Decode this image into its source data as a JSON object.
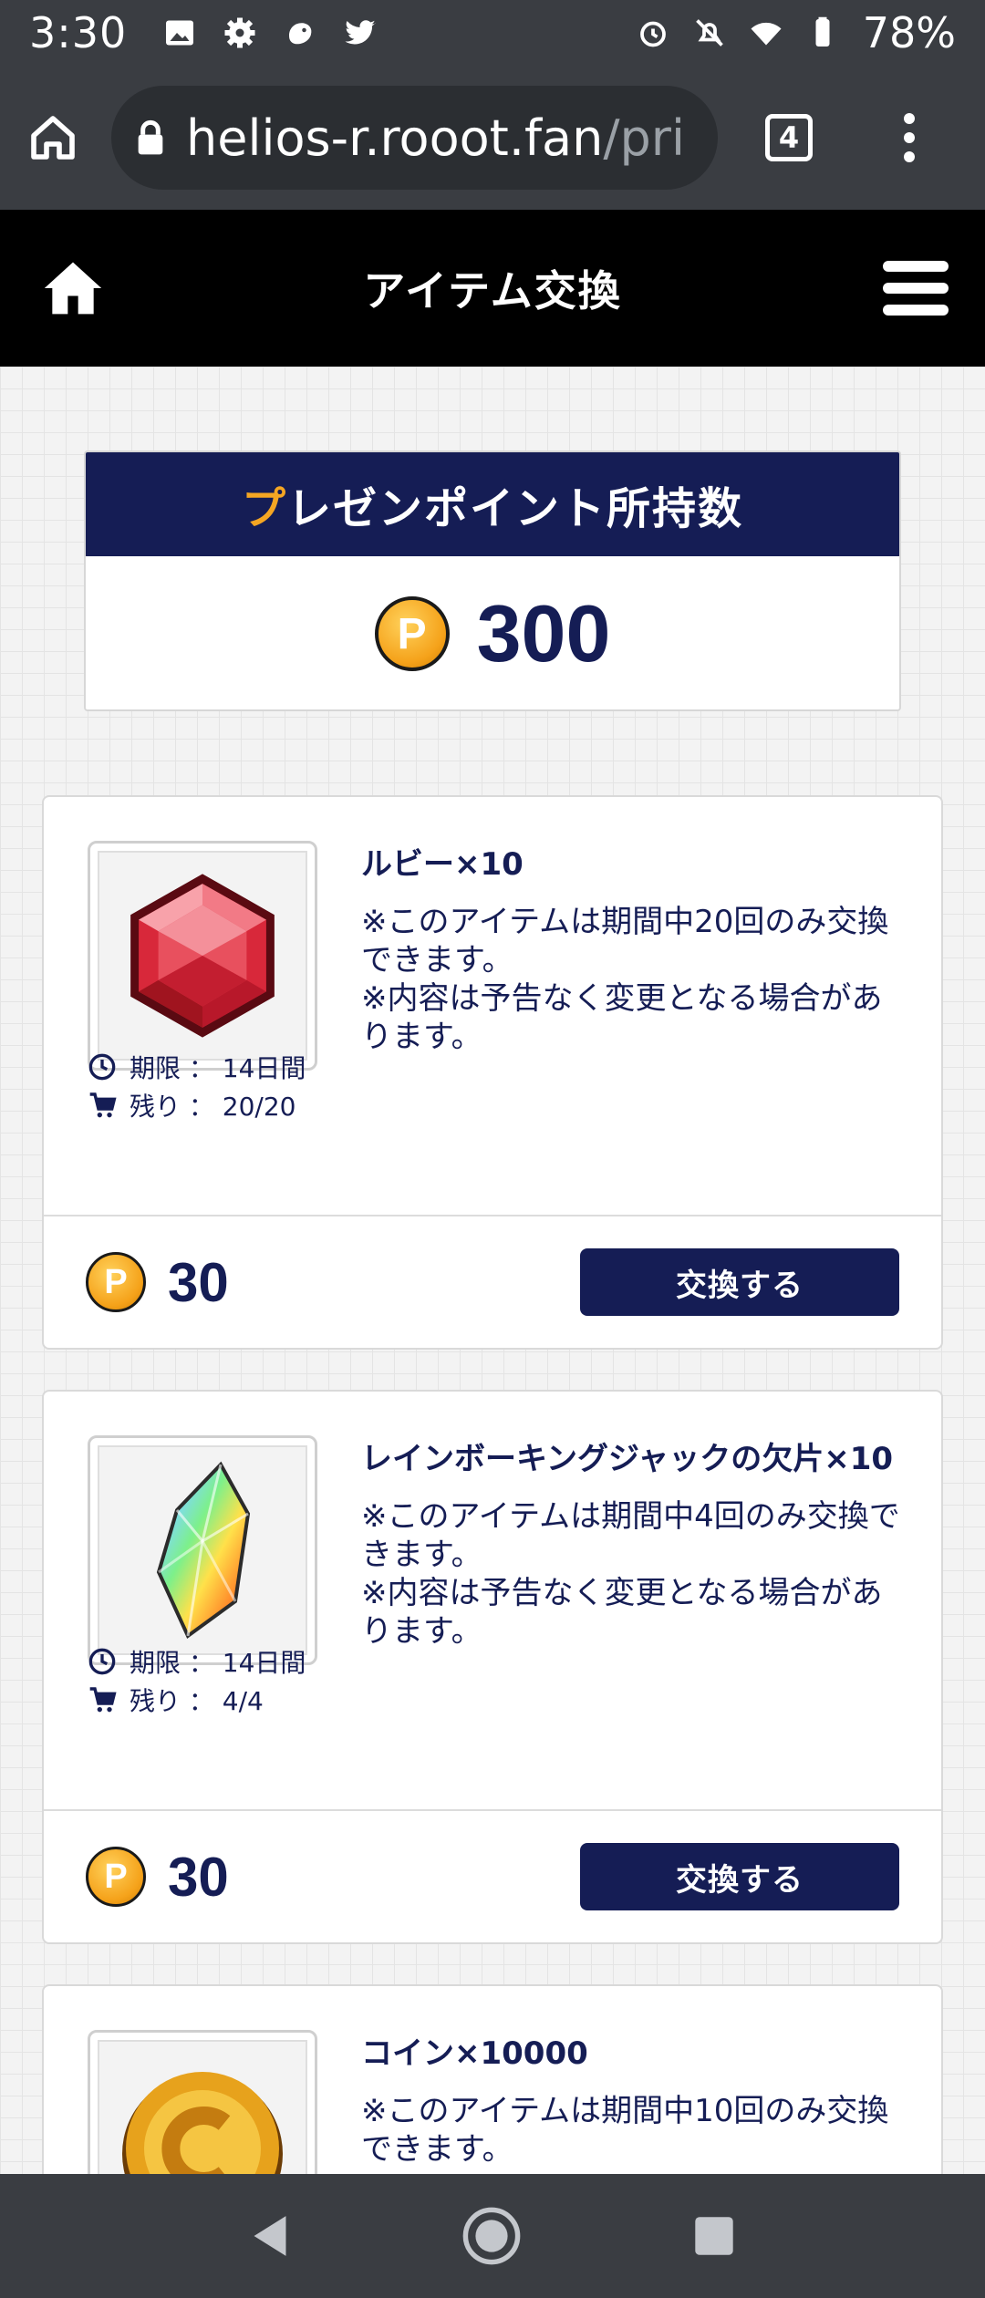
{
  "status_bar": {
    "time": "3:30",
    "battery": "78%",
    "icons": [
      "image-icon",
      "gear-icon",
      "app-icon",
      "twitter-icon",
      "alarm-icon",
      "bell-off-icon",
      "wifi-icon",
      "battery-icon"
    ]
  },
  "browser": {
    "url_main": "helios-r.rooot.fan",
    "url_dim": "/pri",
    "tab_count": "4"
  },
  "header": {
    "title": "アイテム交換"
  },
  "points": {
    "label_first": "プ",
    "label_rest": "レゼンポイント所持数",
    "coin_symbol": "P",
    "value": "300"
  },
  "items": [
    {
      "name": "ルビー×10",
      "description": "※このアイテムは期間中20回のみ交換できます。\n※内容は予告なく変更となる場合があります。",
      "period_label": "期限 ： 14日間",
      "remaining_label": "残り ： 20/20",
      "cost": "30",
      "button": "交換する",
      "image": "ruby-gem"
    },
    {
      "name": "レインボーキングジャックの欠片×10",
      "description": "※このアイテムは期間中4回のみ交換できます。\n※内容は予告なく変更となる場合があります。",
      "period_label": "期限 ： 14日間",
      "remaining_label": "残り ： 4/4",
      "cost": "30",
      "button": "交換する",
      "image": "rainbow-crystal"
    },
    {
      "name": "コイン×10000",
      "description": "※このアイテムは期間中10回のみ交換できます。",
      "image": "gold-coin"
    }
  ],
  "colors": {
    "navy": "#151d55",
    "accent_orange": "#f5a623",
    "chrome": "#3a3d42"
  }
}
